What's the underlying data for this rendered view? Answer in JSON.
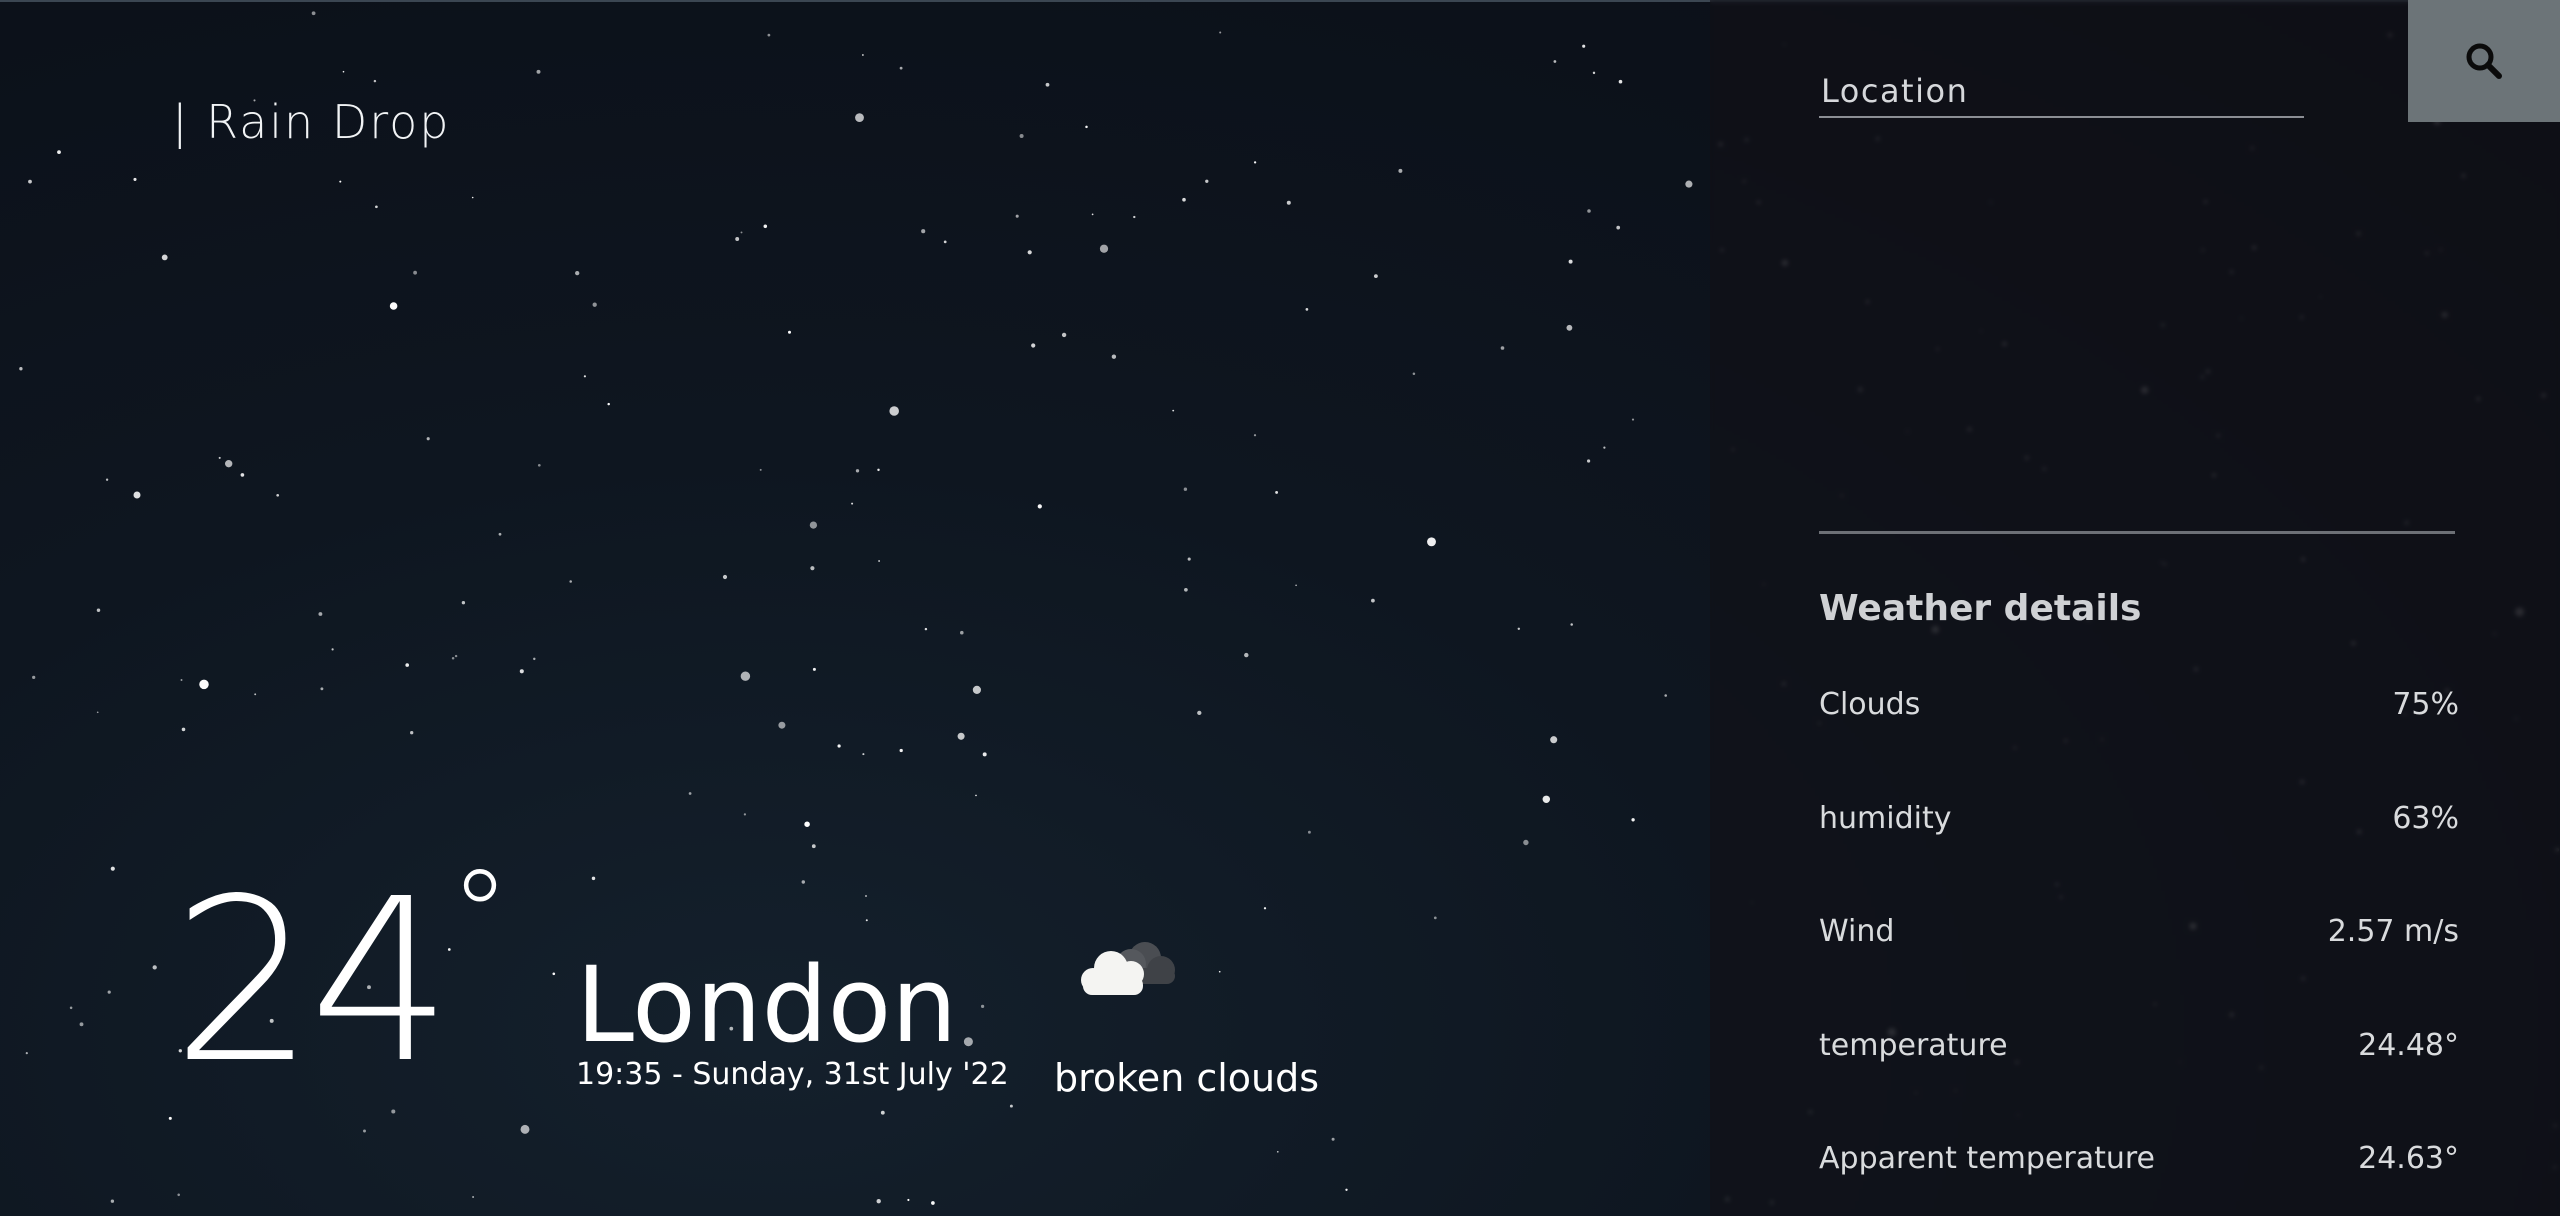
{
  "app": {
    "brand": "| Rain Drop"
  },
  "current": {
    "temperature": "24",
    "degree_symbol": "°",
    "city": "London",
    "datetime": "19:35 - Sunday, 31st July '22",
    "condition": "broken clouds",
    "icon": "broken-clouds-icon"
  },
  "search": {
    "placeholder": "Location",
    "value": "",
    "button_icon": "search-icon"
  },
  "details": {
    "heading": "Weather details",
    "rows": [
      {
        "label": "Clouds",
        "value": "75%"
      },
      {
        "label": "humidity",
        "value": "63%"
      },
      {
        "label": "Wind",
        "value": "2.57 m/s"
      },
      {
        "label": "temperature",
        "value": "24.48°"
      },
      {
        "label": "Apparent temperature",
        "value": "24.63°"
      }
    ]
  },
  "colors": {
    "background": "#0d1119",
    "panel": "#121016",
    "search_button": "#6c7478",
    "text": "#ffffff",
    "muted_text": "#d9dbdd"
  }
}
